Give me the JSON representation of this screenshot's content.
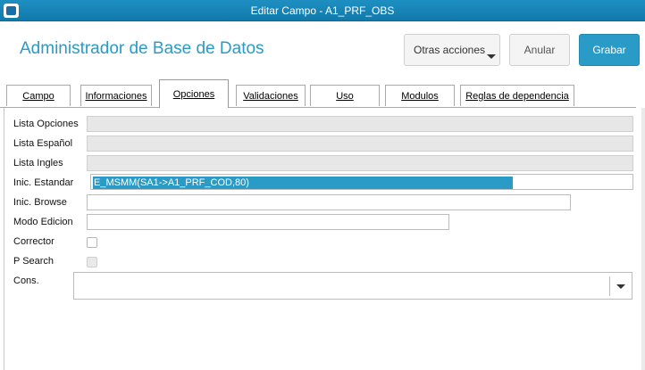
{
  "window": {
    "title": "Editar Campo - A1_PRF_OBS"
  },
  "header": {
    "app_title": "Administrador de Base de Datos",
    "buttons": {
      "otras": "Otras acciones",
      "anular": "Anular",
      "grabar": "Grabar"
    }
  },
  "tabs": [
    {
      "label": "Campo"
    },
    {
      "label": "Informaciones"
    },
    {
      "label": "Opciones",
      "active": true
    },
    {
      "label": "Validaciones"
    },
    {
      "label": "Uso"
    },
    {
      "label": "Modulos"
    },
    {
      "label": "Reglas de dependencia"
    }
  ],
  "form": {
    "lista_opciones": {
      "label": "Lista Opciones",
      "value": ""
    },
    "lista_espanol": {
      "label": "Lista Español",
      "value": ""
    },
    "lista_ingles": {
      "label": "Lista Ingles",
      "value": ""
    },
    "inic_estandar": {
      "label": "Inic. Estandar",
      "value": "E_MSMM(SA1->A1_PRF_COD,80)"
    },
    "inic_browse": {
      "label": "Inic. Browse",
      "value": ""
    },
    "modo_edicion": {
      "label": "Modo Edicion",
      "value": ""
    },
    "corrector": {
      "label": "Corrector"
    },
    "p_search": {
      "label": "P Search"
    },
    "cons": {
      "label": "Cons.",
      "value": ""
    }
  },
  "colors": {
    "accent": "#2a9ac7",
    "titlebar": "#1584b8"
  },
  "icons": {
    "app": "app-window-icon",
    "dropdown": "chevron-down-icon"
  }
}
